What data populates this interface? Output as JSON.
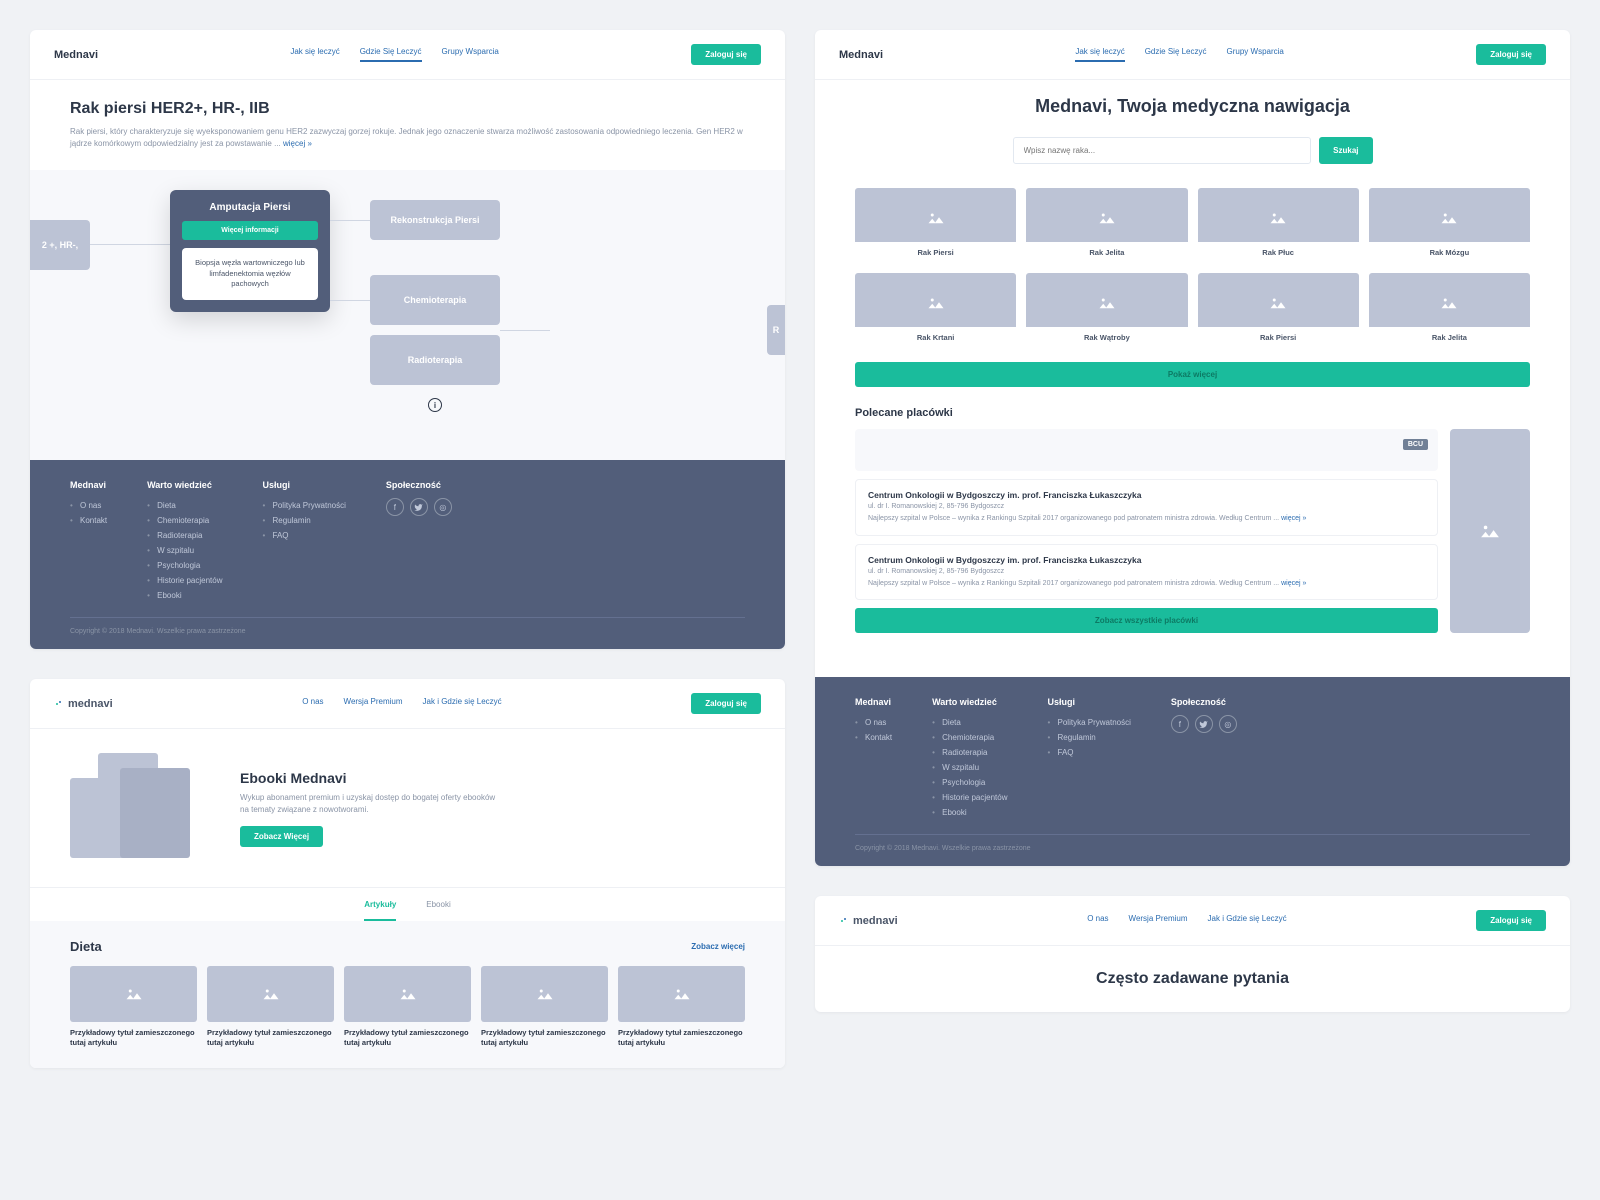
{
  "colors": {
    "accent": "#1abc9c",
    "link": "#2b6cb0",
    "dark": "#525e7a",
    "muted": "#bcc3d5"
  },
  "brand": "Mednavi",
  "brandLower": "mednavi",
  "nav1": {
    "items": [
      "Jak się leczyć",
      "Gdzie Się Leczyć",
      "Grupy Wsparcia"
    ],
    "login": "Zaloguj się"
  },
  "nav2": {
    "items": [
      "O nas",
      "Wersja Premium",
      "Jak i Gdzie się Leczyć"
    ],
    "login": "Zaloguj się"
  },
  "panel1": {
    "title": "Rak piersi HER2+, HR-, IIB",
    "desc": "Rak piersi, który charakteryzuje się wyeksponowaniem genu HER2 zazwyczaj gorzej rokuje. Jednak jego oznaczenie stwarza możliwość zastosowania odpowiedniego leczenia. Gen HER2 w jądrze komórkowym odpowiedzialny jest za powstawanie ...",
    "more": "więcej »",
    "flow": {
      "root": "2 +, HR-,",
      "main": "Amputacja Piersi",
      "mainBtn": "Więcej informacji",
      "sub": "Biopsja węzła wartowniczego lub limfadenektomia węzłów pachowych",
      "b1": "Rekonstrukcja Piersi",
      "b2": "Chemioterapia",
      "b3": "Radioterapia",
      "b4": "R"
    }
  },
  "footer": {
    "cols": [
      {
        "h": "Mednavi",
        "items": [
          "O nas",
          "Kontakt"
        ]
      },
      {
        "h": "Warto wiedzieć",
        "items": [
          "Dieta",
          "Chemioterapia",
          "Radioterapia",
          "W szpitalu",
          "Psychologia",
          "Historie pacjentów",
          "Ebooki"
        ]
      },
      {
        "h": "Usługi",
        "items": [
          "Polityka Prywatności",
          "Regulamin",
          "FAQ"
        ]
      },
      {
        "h": "Społeczność",
        "items": []
      }
    ],
    "copy": "Copyright © 2018 Mednavi. Wszelkie prawa zastrzeżone"
  },
  "panel2": {
    "headline": "Mednavi, Twoja medyczna nawigacja",
    "searchPh": "Wpisz nazwę raka...",
    "searchBtn": "Szukaj",
    "cards": [
      "Rak Piersi",
      "Rak Jelita",
      "Rak Płuc",
      "Rak Mózgu",
      "Rak Krtani",
      "Rak Wątroby",
      "Rak Piersi",
      "Rak Jelita"
    ],
    "showMore": "Pokaż więcej",
    "facilitiesHead": "Polecane placówki",
    "facility": {
      "badge": "BCU",
      "title": "Centrum Onkologii w Bydgoszczy im. prof. Franciszka Łukaszczyka",
      "addr": "ul. dr I. Romanowskiej 2, 85-796 Bydgoszcz",
      "desc": "Najlepszy szpital w Polsce – wynika z Rankingu Szpitali 2017 organizowanego pod patronatem ministra zdrowia. Według Centrum ... ",
      "more": "więcej »"
    },
    "facilitiesAll": "Zobacz wszystkie placówki"
  },
  "panel3": {
    "title": "Ebooki Mednavi",
    "desc": "Wykup abonament premium i uzyskaj dostęp do bogatej oferty ebooków na tematy związane z nowotworami.",
    "btn": "Zobacz Więcej",
    "tabs": [
      "Artykuły",
      "Ebooki"
    ],
    "articlesHead": "Dieta",
    "seeMore": "Zobacz więcej",
    "articleTitle": "Przykładowy tytuł zamieszczonego tutaj artykułu"
  },
  "panel4": {
    "faq": "Często zadawane pytania"
  }
}
